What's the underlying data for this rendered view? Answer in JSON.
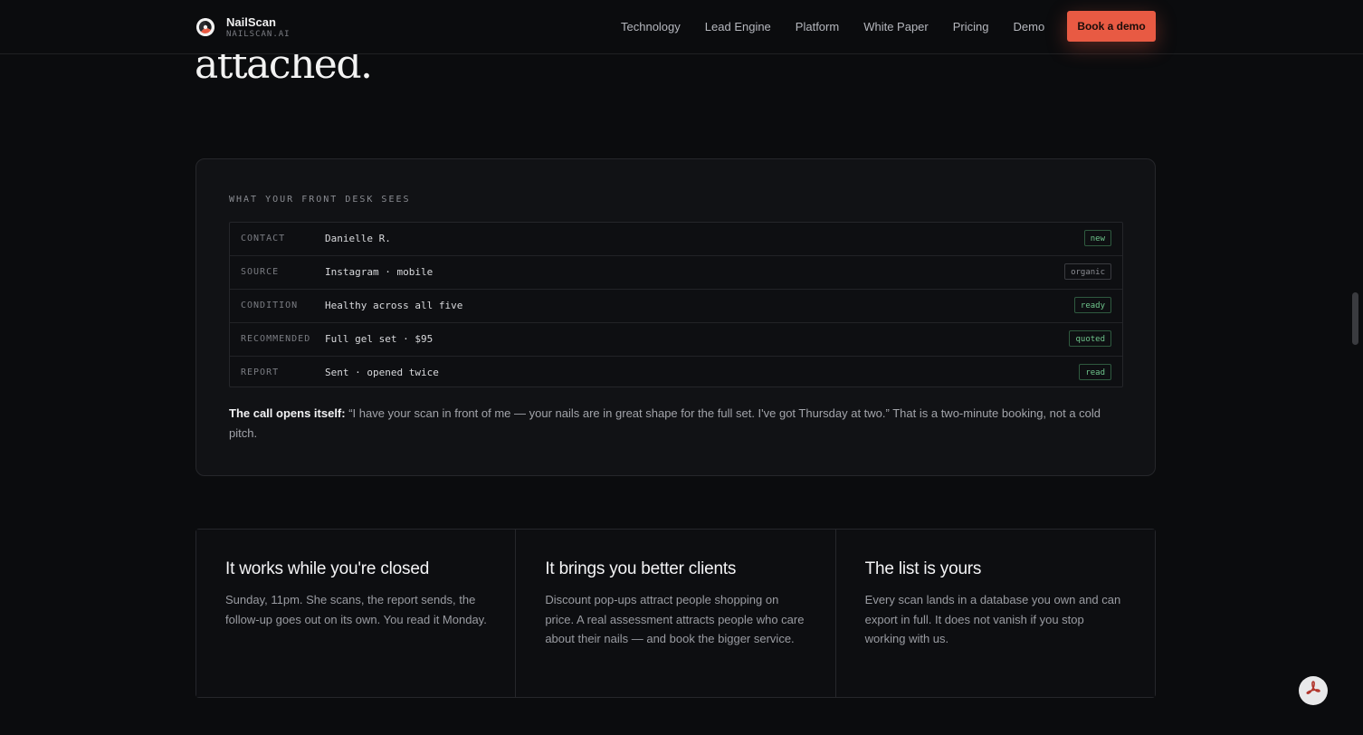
{
  "brand": {
    "name": "NailScan",
    "sub": "NAILSCAN.AI"
  },
  "nav": {
    "links": [
      "Technology",
      "Lead Engine",
      "Platform",
      "White Paper",
      "Pricing",
      "Demo"
    ],
    "cta": "Book a demo"
  },
  "headline": "attached.",
  "card": {
    "label": "WHAT YOUR FRONT DESK SEES",
    "rows": [
      {
        "key": "CONTACT",
        "value": "Danielle R.",
        "badge": "new"
      },
      {
        "key": "SOURCE",
        "value": "Instagram · mobile",
        "badge": "organic"
      },
      {
        "key": "CONDITION",
        "value": "Healthy across all five",
        "badge": "ready"
      },
      {
        "key": "RECOMMENDED",
        "value": "Full gel set · $95",
        "badge": "quoted"
      },
      {
        "key": "REPORT",
        "value": "Sent · opened twice",
        "badge": "read"
      }
    ],
    "quote_lead": "The call opens itself:",
    "quote_text": " “I have your scan in front of me — your nails are in great shape for the full set. I've got Thursday at two.” That is a two-minute booking, not a cold pitch."
  },
  "features": [
    {
      "title": "It works while you're closed",
      "body": "Sunday, 11pm. She scans, the report sends, the follow-up goes out on its own. You read it Monday."
    },
    {
      "title": "It brings you better clients",
      "body": "Discount pop-ups attract people shopping on price. A real assessment attracts people who care about their nails — and book the bigger service."
    },
    {
      "title": "The list is yours",
      "body": "Every scan lands in a database you own and can export in full. It does not vanish if you stop working with us."
    }
  ],
  "colors": {
    "accent": "#e85a43",
    "badge_green": "#6fc58c",
    "background": "#0b0c0e"
  },
  "icons": {
    "logo": "nailscan-logo-icon",
    "floating": "pdf-icon"
  }
}
